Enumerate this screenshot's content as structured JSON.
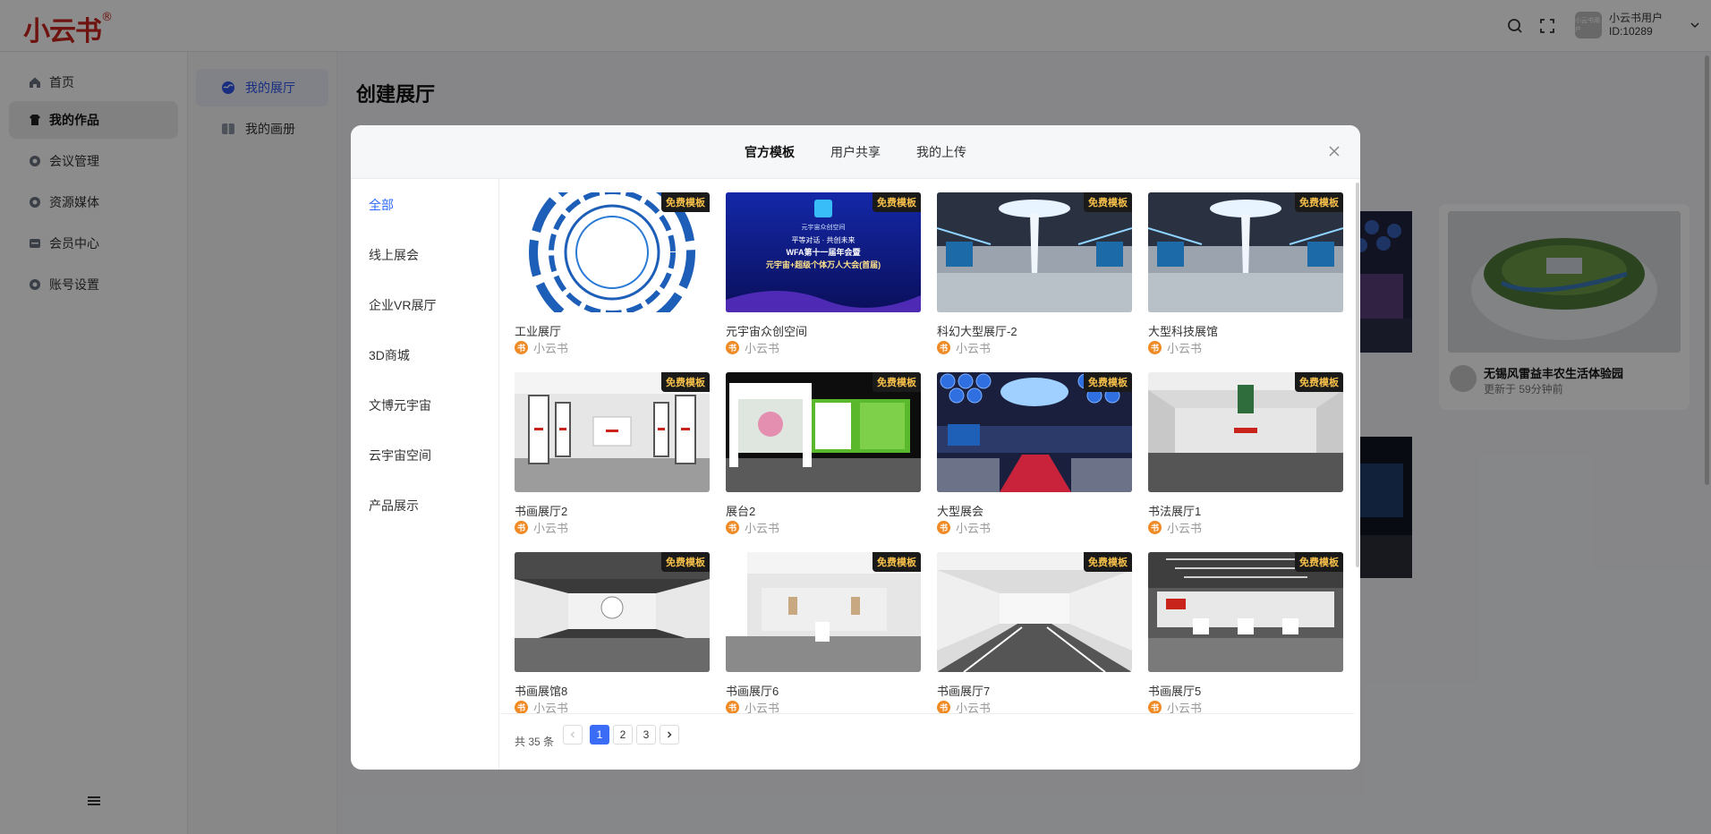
{
  "app": {
    "logo_text": "小云书",
    "logo_mark": "®",
    "user": {
      "avatar_label": "小云书用户",
      "name": "小云书用户",
      "id": "ID:10289"
    }
  },
  "sidebar": {
    "items": [
      {
        "label": "首页",
        "icon": "home-icon"
      },
      {
        "label": "我的作品",
        "icon": "shirt-icon"
      },
      {
        "label": "会议管理",
        "icon": "circle-icon"
      },
      {
        "label": "资源媒体",
        "icon": "circle-icon"
      },
      {
        "label": "会员中心",
        "icon": "card-icon"
      },
      {
        "label": "账号设置",
        "icon": "circle-icon"
      }
    ]
  },
  "subnav": {
    "items": [
      {
        "label": "我的展厅",
        "icon": "globe-icon"
      },
      {
        "label": "我的画册",
        "icon": "book-icon"
      }
    ]
  },
  "main": {
    "title": "创建展厅",
    "bg_card": {
      "title": "无锡风雷益丰农生活体验园",
      "subtitle": "更新于 59分钟前"
    }
  },
  "modal": {
    "tabs": [
      "官方模板",
      "用户共享",
      "我的上传"
    ],
    "categories": [
      "全部",
      "线上展会",
      "企业VR展厅",
      "3D商城",
      "文博元宇宙",
      "云宇宙空间",
      "产品展示"
    ],
    "badge_label": "免费模板",
    "author_initial": "书",
    "templates": [
      {
        "title": "工业展厅",
        "author": "小云书"
      },
      {
        "title": "元宇宙众创空间",
        "author": "小云书"
      },
      {
        "title": "科幻大型展厅-2",
        "author": "小云书"
      },
      {
        "title": "大型科技展馆",
        "author": "小云书"
      },
      {
        "title": "书画展厅2",
        "author": "小云书"
      },
      {
        "title": "展台2",
        "author": "小云书"
      },
      {
        "title": "大型展会",
        "author": "小云书"
      },
      {
        "title": "书法展厅1",
        "author": "小云书"
      },
      {
        "title": "书画展馆8",
        "author": "小云书"
      },
      {
        "title": "书画展厅6",
        "author": "小云书"
      },
      {
        "title": "书画展厅7",
        "author": "小云书"
      },
      {
        "title": "书画展厅5",
        "author": "小云书"
      }
    ],
    "poster": {
      "brand": "元宇宙众创空间",
      "line1": "平等对话 · 共创未来",
      "line2": "WFA第十一届年会暨",
      "line3": "元宇宙+超级个体万人大会(首届)"
    },
    "pagination": {
      "total": "共 35 条",
      "pages": [
        "1",
        "2",
        "3"
      ],
      "current": "1"
    }
  },
  "colors": {
    "accent": "#2f6bff",
    "badge_bg": "#1a1a1a",
    "badge_text": "#f7c04a",
    "logo": "#c8241c",
    "author_icon": "#f08a24"
  }
}
